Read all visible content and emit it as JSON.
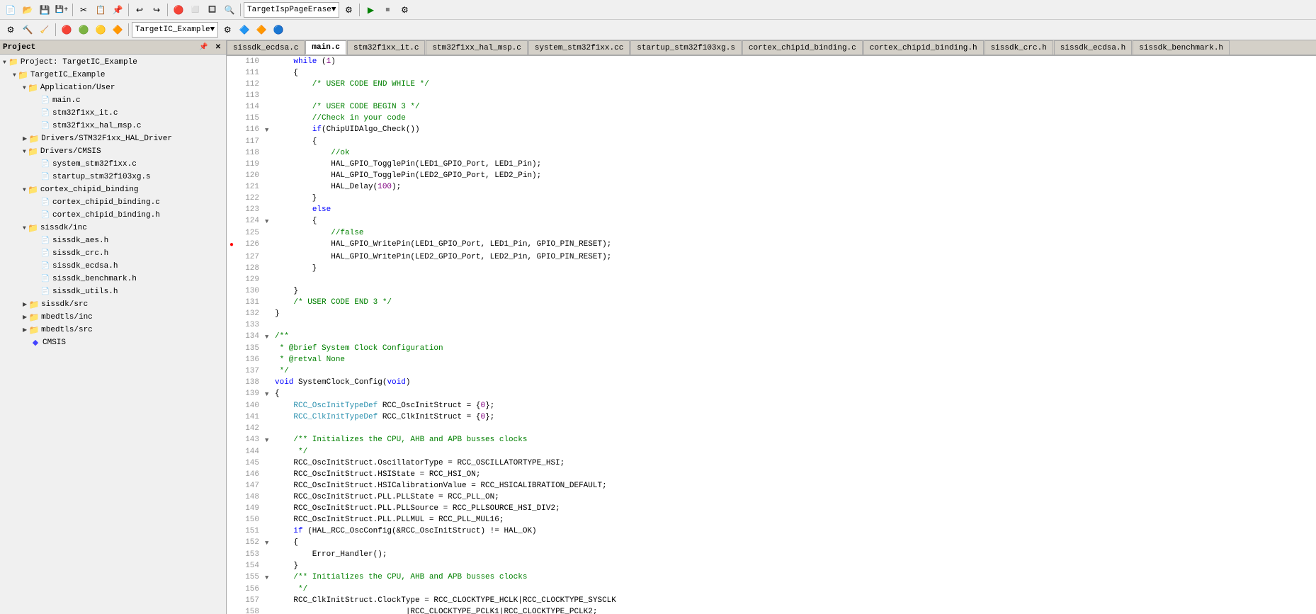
{
  "app": {
    "title": "Project"
  },
  "toolbar": {
    "row1_buttons": [
      "📂",
      "💾",
      "🖨",
      "✂",
      "📋",
      "📄",
      "↩",
      "↪",
      "▶",
      "⏸",
      "⏹",
      "🔍"
    ],
    "target_dropdown": "TargetIspPageErase",
    "row2_buttons": [
      "⚙",
      "🔨",
      "🔧",
      "🔵",
      "🔴",
      "🟡",
      "🔮"
    ],
    "project_dropdown": "TargetIC_Example"
  },
  "left_panel": {
    "title": "Project",
    "tree": [
      {
        "id": "root",
        "label": "Project: TargetIC_Example",
        "level": 0,
        "type": "project",
        "expanded": true
      },
      {
        "id": "targetIC",
        "label": "TargetIC_Example",
        "level": 1,
        "type": "folder",
        "expanded": true
      },
      {
        "id": "app_user",
        "label": "Application/User",
        "level": 2,
        "type": "folder",
        "expanded": true
      },
      {
        "id": "main_c",
        "label": "main.c",
        "level": 3,
        "type": "file"
      },
      {
        "id": "stm32f1xx_it_c",
        "label": "stm32f1xx_it.c",
        "level": 3,
        "type": "file"
      },
      {
        "id": "stm32f1xx_hal_msp_c",
        "label": "stm32f1xx_hal_msp.c",
        "level": 3,
        "type": "file"
      },
      {
        "id": "drivers_stm",
        "label": "Drivers/STM32F1xx_HAL_Driver",
        "level": 2,
        "type": "folder",
        "expanded": false
      },
      {
        "id": "drivers_cmsis",
        "label": "Drivers/CMSIS",
        "level": 2,
        "type": "folder",
        "expanded": true
      },
      {
        "id": "system_stm32f1xx_c",
        "label": "system_stm32f1xx.c",
        "level": 3,
        "type": "file"
      },
      {
        "id": "startup_stm32f103xg_s",
        "label": "startup_stm32f103xg.s",
        "level": 3,
        "type": "file"
      },
      {
        "id": "cortex_chipid_binding",
        "label": "cortex_chipid_binding",
        "level": 2,
        "type": "folder",
        "expanded": true
      },
      {
        "id": "cortex_chipid_binding_c",
        "label": "cortex_chipid_binding.c",
        "level": 3,
        "type": "file"
      },
      {
        "id": "cortex_chipid_binding_h",
        "label": "cortex_chipid_binding.h",
        "level": 3,
        "type": "file"
      },
      {
        "id": "sissdk_inc",
        "label": "sissdk/inc",
        "level": 2,
        "type": "folder",
        "expanded": true
      },
      {
        "id": "sissdk_aes_h",
        "label": "sissdk_aes.h",
        "level": 3,
        "type": "file"
      },
      {
        "id": "sissdk_crc_h",
        "label": "sissdk_crc.h",
        "level": 3,
        "type": "file"
      },
      {
        "id": "sissdk_ecdsa_h",
        "label": "sissdk_ecdsa.h",
        "level": 3,
        "type": "file"
      },
      {
        "id": "sissdk_benchmark_h",
        "label": "sissdk_benchmark.h",
        "level": 3,
        "type": "file"
      },
      {
        "id": "sissdk_utils_h",
        "label": "sissdk_utils.h",
        "level": 3,
        "type": "file"
      },
      {
        "id": "sissdk_src",
        "label": "sissdk/src",
        "level": 2,
        "type": "folder",
        "expanded": false
      },
      {
        "id": "mbedtls_inc",
        "label": "mbedtls/inc",
        "level": 2,
        "type": "folder",
        "expanded": false
      },
      {
        "id": "mbedtls_src",
        "label": "mbedtls/src",
        "level": 2,
        "type": "folder",
        "expanded": false
      },
      {
        "id": "cmsis",
        "label": "CMSIS",
        "level": 2,
        "type": "gem"
      }
    ]
  },
  "tabs": [
    {
      "id": "sissdk_ecdsa_a",
      "label": "sissdk_ecdsa.c",
      "active": false
    },
    {
      "id": "main_c",
      "label": "main.c",
      "active": true
    },
    {
      "id": "stm32f1xx_it_c",
      "label": "stm32f1xx_it.c",
      "active": false
    },
    {
      "id": "stm32f1xx_hal_msp_c",
      "label": "stm32f1xx_hal_msp.c",
      "active": false
    },
    {
      "id": "system_stm32f1xx_c",
      "label": "system_stm32f1xx.cc",
      "active": false
    },
    {
      "id": "startup",
      "label": "startup_stm32f103xg.s",
      "active": false
    },
    {
      "id": "cortex_c",
      "label": "cortex_chipid_binding.c",
      "active": false
    },
    {
      "id": "cortex_h",
      "label": "cortex_chipid_binding.h",
      "active": false
    },
    {
      "id": "sissdk_crc_h",
      "label": "sissdk_crc.h",
      "active": false
    },
    {
      "id": "sissdk_ecdsa_h",
      "label": "sissdk_ecdsa.h",
      "active": false
    },
    {
      "id": "sissdk_benchmark",
      "label": "sissdk_benchmark.h",
      "active": false
    }
  ],
  "code_lines": [
    {
      "num": 110,
      "collapse": false,
      "content": "    while (1)",
      "indent": "    ",
      "breakpoint": false
    },
    {
      "num": 111,
      "collapse": false,
      "content": "    {",
      "indent": "    ",
      "breakpoint": false
    },
    {
      "num": 112,
      "collapse": false,
      "content": "        /* USER CODE END WHILE */",
      "indent": "        ",
      "breakpoint": false
    },
    {
      "num": 113,
      "collapse": false,
      "content": "",
      "breakpoint": false
    },
    {
      "num": 114,
      "collapse": false,
      "content": "        /* USER CODE BEGIN 3 */",
      "indent": "        ",
      "breakpoint": false
    },
    {
      "num": 115,
      "collapse": false,
      "content": "        //Check in your code",
      "indent": "        ",
      "breakpoint": false
    },
    {
      "num": 116,
      "collapse": true,
      "content": "        if(ChipUIDAlgo_Check())",
      "indent": "        ",
      "breakpoint": false
    },
    {
      "num": 117,
      "collapse": false,
      "content": "        {",
      "indent": "        ",
      "breakpoint": false
    },
    {
      "num": 118,
      "collapse": false,
      "content": "            //ok",
      "indent": "            ",
      "breakpoint": false
    },
    {
      "num": 119,
      "collapse": false,
      "content": "            HAL_GPIO_TogglePin(LED1_GPIO_Port, LED1_Pin);",
      "indent": "            ",
      "breakpoint": false
    },
    {
      "num": 120,
      "collapse": false,
      "content": "            HAL_GPIO_TogglePin(LED2_GPIO_Port, LED2_Pin);",
      "indent": "            ",
      "breakpoint": false
    },
    {
      "num": 121,
      "collapse": false,
      "content": "            HAL_Delay(100);",
      "indent": "            ",
      "breakpoint": false
    },
    {
      "num": 122,
      "collapse": false,
      "content": "        }",
      "indent": "        ",
      "breakpoint": false
    },
    {
      "num": 123,
      "collapse": false,
      "content": "        else",
      "indent": "        ",
      "breakpoint": false
    },
    {
      "num": 124,
      "collapse": true,
      "content": "        {",
      "indent": "        ",
      "breakpoint": false
    },
    {
      "num": 125,
      "collapse": false,
      "content": "            //false",
      "indent": "            ",
      "breakpoint": false
    },
    {
      "num": 126,
      "collapse": false,
      "content": "            HAL_GPIO_WritePin(LED1_GPIO_Port, LED1_Pin, GPIO_PIN_RESET);",
      "indent": "            ",
      "breakpoint": true
    },
    {
      "num": 127,
      "collapse": false,
      "content": "            HAL_GPIO_WritePin(LED2_GPIO_Port, LED2_Pin, GPIO_PIN_RESET);",
      "indent": "            ",
      "breakpoint": false
    },
    {
      "num": 128,
      "collapse": false,
      "content": "        }",
      "indent": "        ",
      "breakpoint": false
    },
    {
      "num": 129,
      "collapse": false,
      "content": "",
      "breakpoint": false
    },
    {
      "num": 130,
      "collapse": false,
      "content": "    }",
      "indent": "    ",
      "breakpoint": false
    },
    {
      "num": 131,
      "collapse": false,
      "content": "    /* USER CODE END 3 */",
      "indent": "    ",
      "breakpoint": false
    },
    {
      "num": 132,
      "collapse": false,
      "content": "}",
      "breakpoint": false
    },
    {
      "num": 133,
      "collapse": false,
      "content": "",
      "breakpoint": false
    },
    {
      "num": 134,
      "collapse": true,
      "content": "/**",
      "breakpoint": false
    },
    {
      "num": 135,
      "collapse": false,
      "content": " * @brief System Clock Configuration",
      "breakpoint": false
    },
    {
      "num": 136,
      "collapse": false,
      "content": " * @retval None",
      "breakpoint": false
    },
    {
      "num": 137,
      "collapse": false,
      "content": " */",
      "breakpoint": false
    },
    {
      "num": 138,
      "collapse": false,
      "content": "void SystemClock_Config(void)",
      "breakpoint": false
    },
    {
      "num": 139,
      "collapse": true,
      "content": "{",
      "breakpoint": false
    },
    {
      "num": 140,
      "collapse": false,
      "content": "    RCC_OscInitTypeDef RCC_OscInitStruct = {0};",
      "breakpoint": false
    },
    {
      "num": 141,
      "collapse": false,
      "content": "    RCC_ClkInitTypeDef RCC_ClkInitStruct = {0};",
      "breakpoint": false
    },
    {
      "num": 142,
      "collapse": false,
      "content": "",
      "breakpoint": false
    },
    {
      "num": 143,
      "collapse": true,
      "content": "    /** Initializes the CPU, AHB and APB busses clocks",
      "breakpoint": false
    },
    {
      "num": 144,
      "collapse": false,
      "content": "     */",
      "breakpoint": false
    },
    {
      "num": 145,
      "collapse": false,
      "content": "    RCC_OscInitStruct.OscillatorType = RCC_OSCILLATORTYPE_HSI;",
      "breakpoint": false
    },
    {
      "num": 146,
      "collapse": false,
      "content": "    RCC_OscInitStruct.HSIState = RCC_HSI_ON;",
      "breakpoint": false
    },
    {
      "num": 147,
      "collapse": false,
      "content": "    RCC_OscInitStruct.HSICalibrationValue = RCC_HSICALIBRATION_DEFAULT;",
      "breakpoint": false
    },
    {
      "num": 148,
      "collapse": false,
      "content": "    RCC_OscInitStruct.PLL.PLLState = RCC_PLL_ON;",
      "breakpoint": false
    },
    {
      "num": 149,
      "collapse": false,
      "content": "    RCC_OscInitStruct.PLL.PLLSource = RCC_PLLSOURCE_HSI_DIV2;",
      "breakpoint": false
    },
    {
      "num": 150,
      "collapse": false,
      "content": "    RCC_OscInitStruct.PLL.PLLMUL = RCC_PLL_MUL16;",
      "breakpoint": false
    },
    {
      "num": 151,
      "collapse": false,
      "content": "    if (HAL_RCC_OscConfig(&RCC_OscInitStruct) != HAL_OK)",
      "breakpoint": false
    },
    {
      "num": 152,
      "collapse": true,
      "content": "    {",
      "breakpoint": false
    },
    {
      "num": 153,
      "collapse": false,
      "content": "        Error_Handler();",
      "breakpoint": false
    },
    {
      "num": 154,
      "collapse": false,
      "content": "    }",
      "breakpoint": false
    },
    {
      "num": 155,
      "collapse": true,
      "content": "    /** Initializes the CPU, AHB and APB busses clocks",
      "breakpoint": false
    },
    {
      "num": 156,
      "collapse": false,
      "content": "     */",
      "breakpoint": false
    },
    {
      "num": 157,
      "collapse": false,
      "content": "    RCC_ClkInitStruct.ClockType = RCC_CLOCKTYPE_HCLK|RCC_CLOCKTYPE_SYSCLK",
      "breakpoint": false
    },
    {
      "num": 158,
      "collapse": false,
      "content": "                            |RCC_CLOCKTYPE_PCLK1|RCC_CLOCKTYPE_PCLK2;",
      "breakpoint": false
    }
  ]
}
